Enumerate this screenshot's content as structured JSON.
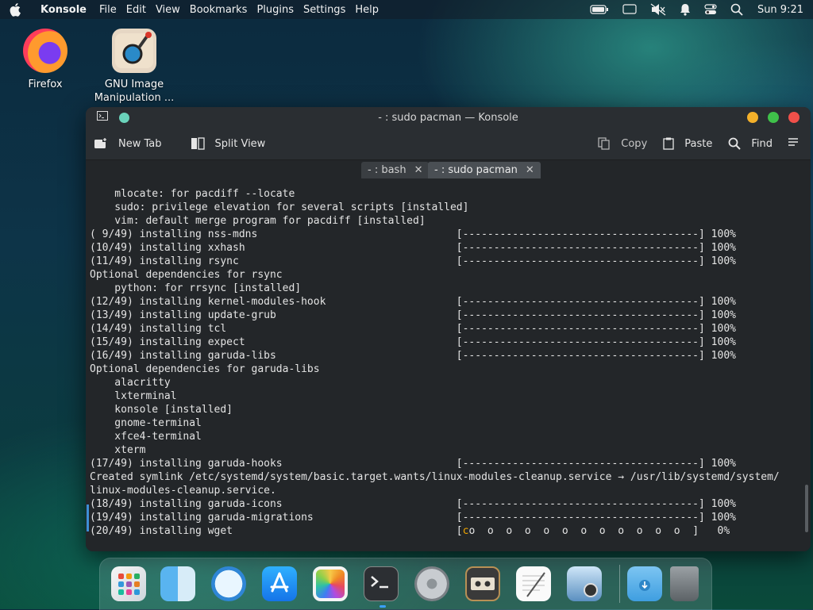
{
  "menubar": {
    "app_name": "Konsole",
    "menus": [
      "File",
      "Edit",
      "View",
      "Bookmarks",
      "Plugins",
      "Settings",
      "Help"
    ],
    "clock": "Sun 9:21"
  },
  "desktop": {
    "icons": [
      {
        "label": "Firefox"
      },
      {
        "label_line1": "GNU Image",
        "label_line2": "Manipulation ..."
      }
    ]
  },
  "window": {
    "title": "- : sudo pacman — Konsole",
    "toolbar": {
      "new_tab": "New Tab",
      "split_view": "Split View",
      "copy": "Copy",
      "paste": "Paste",
      "find": "Find"
    },
    "tabs": [
      {
        "label": "- : bash"
      },
      {
        "label": "- : sudo pacman"
      }
    ],
    "colors": {
      "close": "#f0504a",
      "minimize": "#f3b02a",
      "maximize": "#3fc14a",
      "accent": "#3d8fd6"
    }
  },
  "terminal": {
    "lines": [
      "    mlocate: for pacdiff --locate",
      "    sudo: privilege elevation for several scripts [installed]",
      "    vim: default merge program for pacdiff [installed]",
      "( 9/49) installing nss-mdns                                [--------------------------------------] 100%",
      "(10/49) installing xxhash                                  [--------------------------------------] 100%",
      "(11/49) installing rsync                                   [--------------------------------------] 100%",
      "Optional dependencies for rsync",
      "    python: for rrsync [installed]",
      "(12/49) installing kernel-modules-hook                     [--------------------------------------] 100%",
      "(13/49) installing update-grub                             [--------------------------------------] 100%",
      "(14/49) installing tcl                                     [--------------------------------------] 100%",
      "(15/49) installing expect                                  [--------------------------------------] 100%",
      "(16/49) installing garuda-libs                             [--------------------------------------] 100%",
      "Optional dependencies for garuda-libs",
      "    alacritty",
      "    lxterminal",
      "    konsole [installed]",
      "    gnome-terminal",
      "    xfce4-terminal",
      "    xterm",
      "(17/49) installing garuda-hooks                            [--------------------------------------] 100%",
      "Created symlink /etc/systemd/system/basic.target.wants/linux-modules-cleanup.service → /usr/lib/systemd/system/",
      "linux-modules-cleanup.service.",
      "(18/49) installing garuda-icons                            [--------------------------------------] 100%",
      "(19/49) installing garuda-migrations                       [--------------------------------------] 100%"
    ],
    "last_line_prefix": "(20/49) installing wget                                    [",
    "last_line_cursor": "c",
    "last_line_suffix": "o  o  o  o  o  o  o  o  o  o  o  o  ]   0%"
  },
  "dock": {
    "items": [
      "launchpad-icon",
      "finder-icon",
      "safari-icon",
      "app-store-icon",
      "photos-icon",
      "terminal-icon",
      "system-preferences-icon",
      "cassette-icon",
      "textedit-icon",
      "preview-icon",
      "downloads-folder-icon",
      "trash-icon"
    ]
  }
}
